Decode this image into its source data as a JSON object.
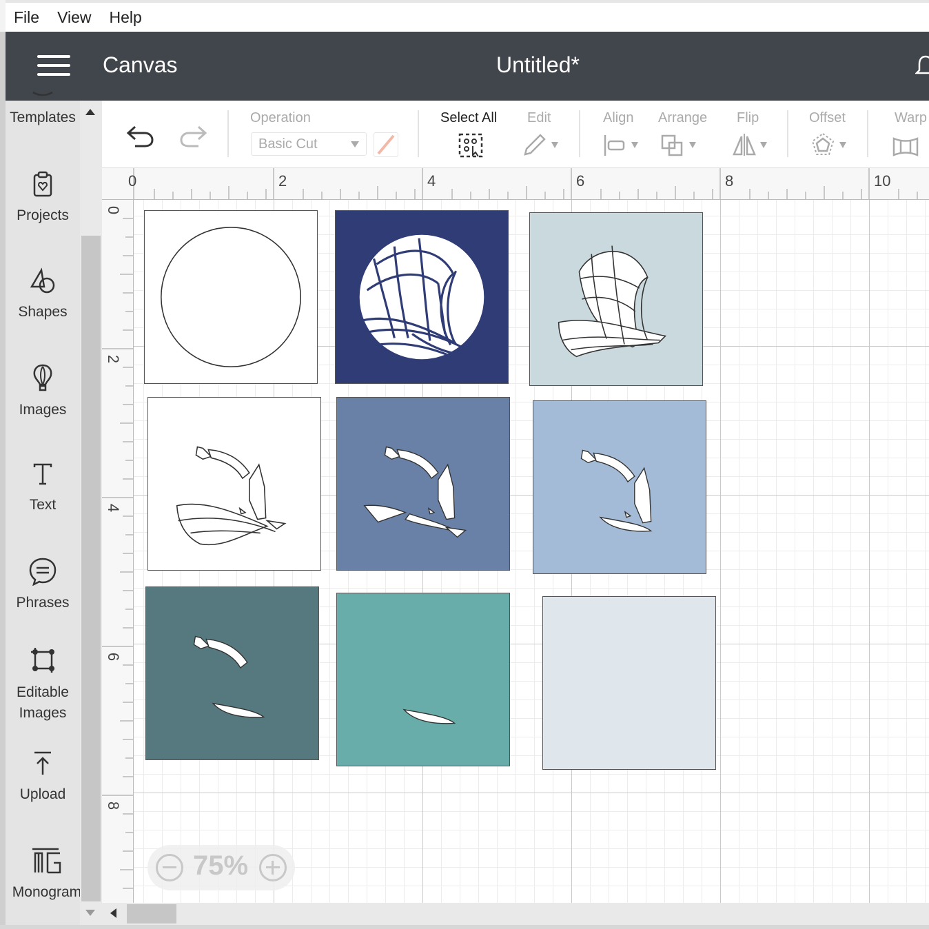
{
  "menu": {
    "items": [
      "File",
      "View",
      "Help"
    ]
  },
  "header": {
    "app_name": "Canvas",
    "doc_title": "Untitled*"
  },
  "sidebar": {
    "items": [
      {
        "label": "Templates",
        "icon": "templates-icon"
      },
      {
        "label": "Projects",
        "icon": "projects-icon"
      },
      {
        "label": "Shapes",
        "icon": "shapes-icon"
      },
      {
        "label": "Images",
        "icon": "images-icon"
      },
      {
        "label": "Text",
        "icon": "text-icon"
      },
      {
        "label": "Phrases",
        "icon": "phrases-icon"
      },
      {
        "label": "Editable\nImages",
        "icon": "editable-images-icon"
      },
      {
        "label": "Upload",
        "icon": "upload-icon"
      },
      {
        "label": "Monogram",
        "icon": "monogram-icon"
      }
    ]
  },
  "toolbar": {
    "operation_label": "Operation",
    "operation_value": "Basic Cut",
    "select_all_label": "Select All",
    "edit_label": "Edit",
    "align_label": "Align",
    "arrange_label": "Arrange",
    "flip_label": "Flip",
    "offset_label": "Offset",
    "warp_label": "Warp"
  },
  "ruler": {
    "top_numbers": [
      "0",
      "2",
      "4",
      "6",
      "8",
      "10"
    ],
    "left_numbers": [
      "0",
      "2",
      "4",
      "6",
      "8"
    ]
  },
  "zoom": {
    "value": "75%"
  },
  "layers": [
    {
      "name": "white-circle-layer",
      "color": "#ffffff"
    },
    {
      "name": "navy-layer",
      "color": "#2f3c75"
    },
    {
      "name": "light-gray-blue-layer",
      "color": "#cad9de"
    },
    {
      "name": "white-ship-layer",
      "color": "#ffffff"
    },
    {
      "name": "slate-blue-layer",
      "color": "#6a81a7"
    },
    {
      "name": "light-blue-layer",
      "color": "#a3bbd6"
    },
    {
      "name": "dark-teal-layer",
      "color": "#55797e"
    },
    {
      "name": "teal-layer",
      "color": "#69adab"
    },
    {
      "name": "pale-gray-layer",
      "color": "#dfe6ec"
    }
  ],
  "colors": {
    "header": "#41454c",
    "sidebar": "#e4e4e4",
    "accent_pen": "#f2b8a8"
  }
}
